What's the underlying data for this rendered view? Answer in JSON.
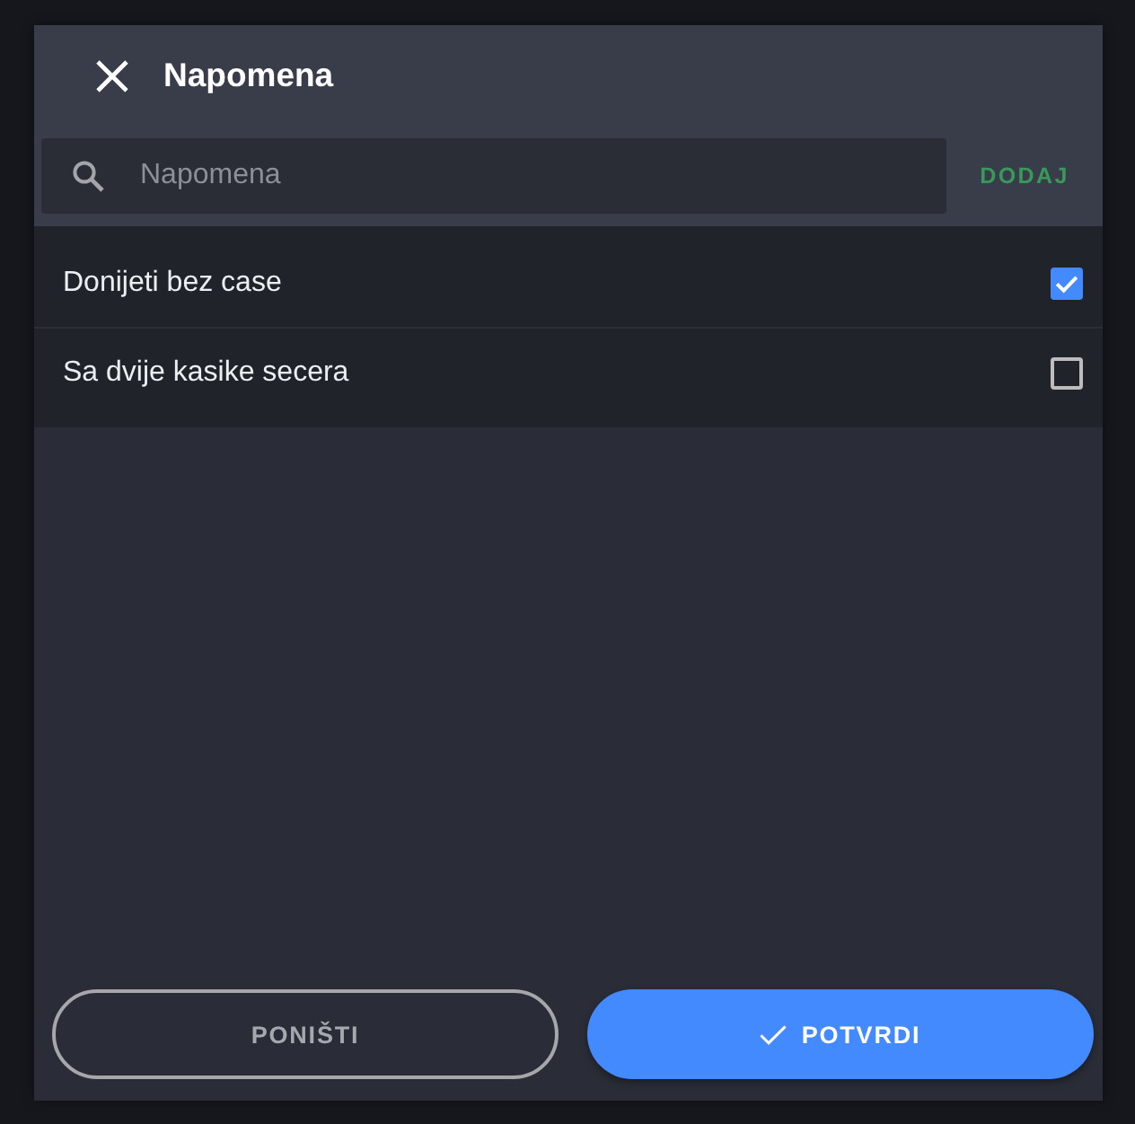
{
  "dialog": {
    "title": "Napomena"
  },
  "search": {
    "placeholder": "Napomena",
    "add_button": "DODAJ"
  },
  "notes": [
    {
      "label": "Donijeti bez case",
      "checked": true
    },
    {
      "label": "Sa dvije kasike secera",
      "checked": false
    }
  ],
  "buttons": [
    {
      "kind": "cancel",
      "label": "PONIŠTI"
    },
    {
      "kind": "confirm",
      "label": "POTVRDI"
    }
  ]
}
